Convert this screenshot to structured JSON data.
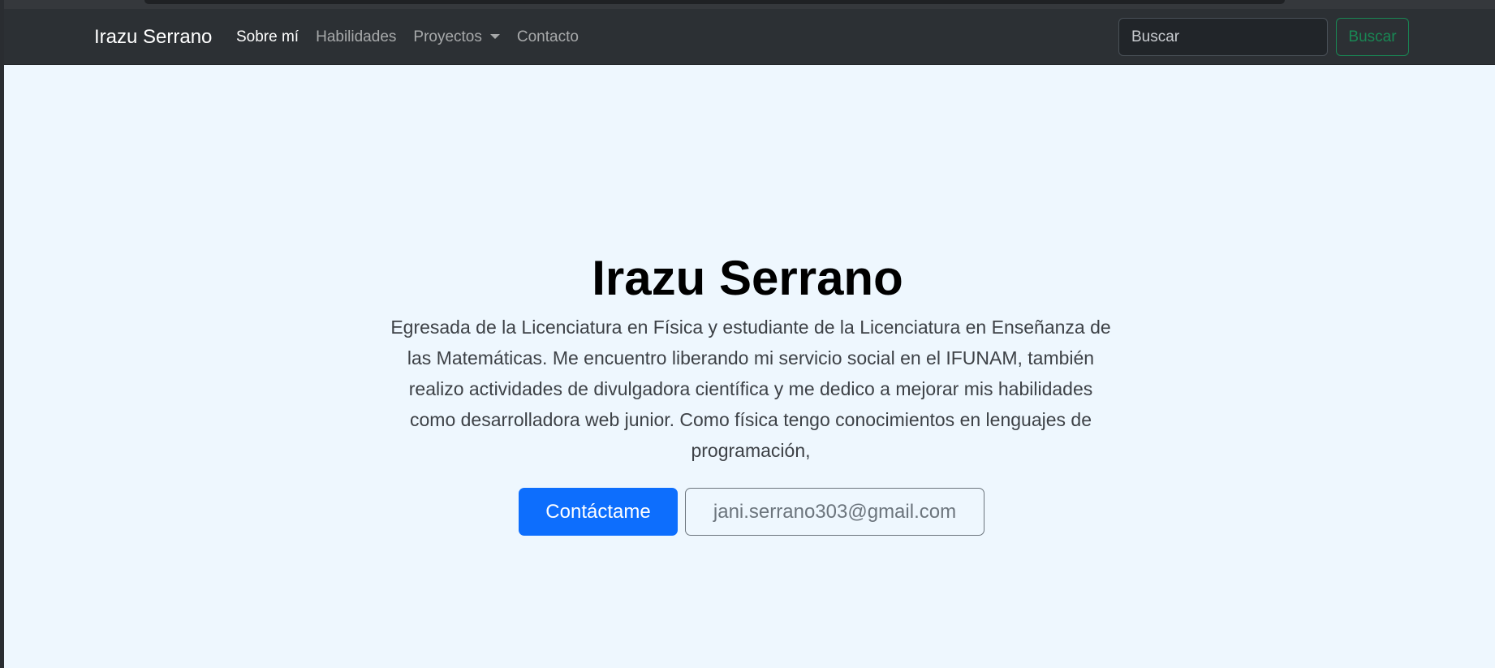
{
  "navbar": {
    "brand": "Irazu Serrano",
    "links": [
      {
        "label": "Sobre mí",
        "active": true
      },
      {
        "label": "Habilidades",
        "active": false
      },
      {
        "label": "Proyectos",
        "active": false,
        "dropdown": true
      },
      {
        "label": "Contacto",
        "active": false
      }
    ],
    "search": {
      "placeholder": "Buscar",
      "button_label": "Buscar"
    }
  },
  "hero": {
    "title": "Irazu Serrano",
    "description": "Egresada de la Licenciatura en Física y estudiante de la Licenciatura en Enseñanza de las Matemáticas. Me encuentro liberando mi servicio social en el IFUNAM, también realizo actividades de divulgadora científica y me dedico a mejorar mis habilidades como desarrolladora web junior. Como física tengo conocimientos en lenguajes de programación,",
    "primary_button": "Contáctame",
    "secondary_button": "jani.serrano303@gmail.com"
  },
  "colors": {
    "navbar_bg": "#2c3034",
    "hero_bg": "#eef7fe",
    "primary": "#0d6efd",
    "success": "#198754",
    "secondary": "#6c757d"
  },
  "icons": {
    "dropdown": "chevron-down-icon"
  }
}
